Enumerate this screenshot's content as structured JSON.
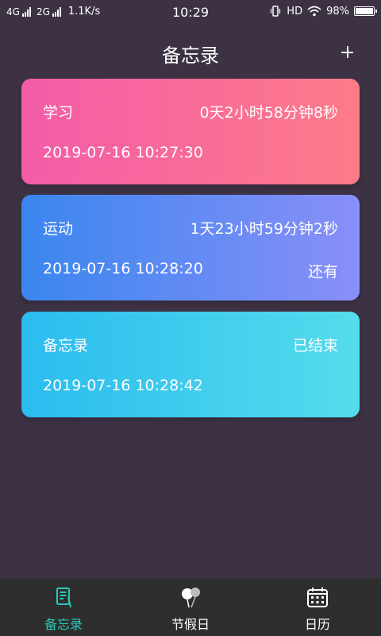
{
  "status_bar": {
    "net1": "4G",
    "net2": "2G",
    "speed": "1.1K/s",
    "time": "10:29",
    "hd": "HD",
    "battery": "98%",
    "battery_level": 0.98
  },
  "header": {
    "title": "备忘录",
    "add_icon": "plus-icon"
  },
  "cards": [
    {
      "title": "学习",
      "countdown": "0天2小时58分钟8秒",
      "date": "2019-07-16 10:27:30",
      "status": "",
      "gradient": [
        "#f45ca9",
        "#fd7b88"
      ]
    },
    {
      "title": "运动",
      "countdown": "1天23小时59分钟2秒",
      "date": "2019-07-16 10:28:20",
      "status": "还有",
      "gradient": [
        "#3a86ef",
        "#8a8ff8"
      ]
    },
    {
      "title": "备忘录",
      "countdown": "已结束",
      "date": "2019-07-16 10:28:42",
      "status": "",
      "gradient": [
        "#2bbcef",
        "#55dcec"
      ]
    }
  ],
  "bottom_nav": {
    "items": [
      {
        "label": "备忘录",
        "icon": "memo-icon",
        "active": true
      },
      {
        "label": "节假日",
        "icon": "holiday-balloon-icon",
        "active": false
      },
      {
        "label": "日历",
        "icon": "calendar-icon",
        "active": false
      }
    ]
  },
  "colors": {
    "background": "#3d3244",
    "nav_background": "#2e2e2e",
    "accent": "#29c7b8"
  }
}
